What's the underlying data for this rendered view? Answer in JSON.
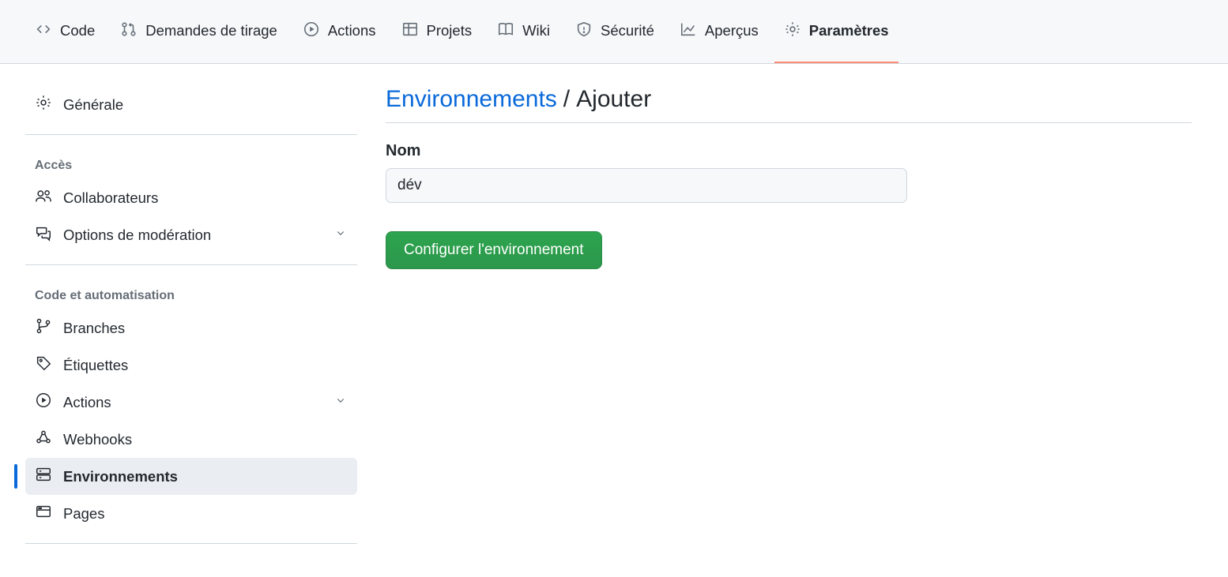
{
  "tabs": {
    "code": "Code",
    "pulls": "Demandes de tirage",
    "actions": "Actions",
    "projects": "Projets",
    "wiki": "Wiki",
    "security": "Sécurité",
    "insights": "Aperçus",
    "settings": "Paramètres"
  },
  "sidebar": {
    "general": "Générale",
    "section_access": "Accès",
    "collaborators": "Collaborateurs",
    "moderation": "Options de modération",
    "section_code_auto": "Code et automatisation",
    "branches": "Branches",
    "tags": "Étiquettes",
    "actions": "Actions",
    "webhooks": "Webhooks",
    "environments": "Environnements",
    "pages": "Pages"
  },
  "page": {
    "breadcrumb_parent": "Environnements",
    "breadcrumb_sep": "/",
    "breadcrumb_current": "Ajouter",
    "name_label": "Nom",
    "name_value": "dév",
    "submit_button": "Configurer l'environnement"
  }
}
